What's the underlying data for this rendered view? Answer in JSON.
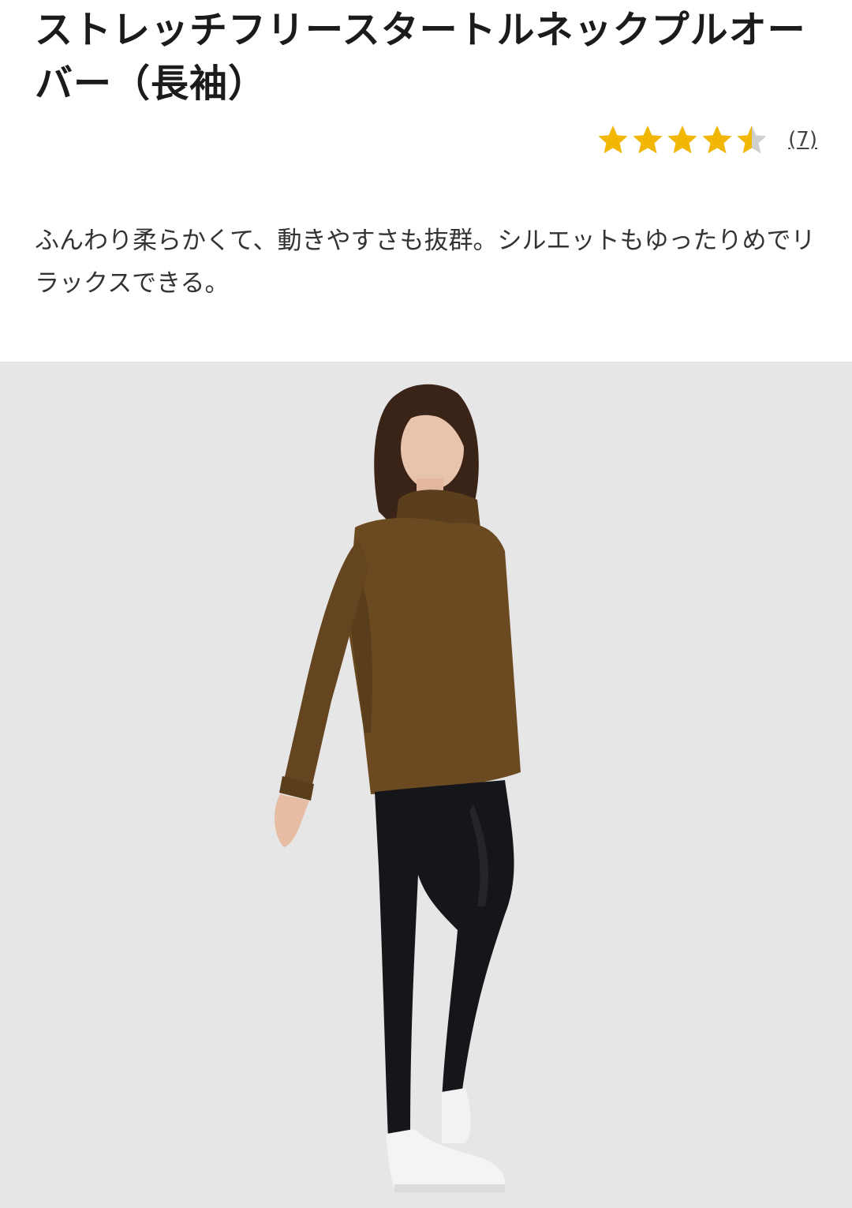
{
  "product": {
    "title": "ストレッチフリースタートルネックプルオーバー（長袖）",
    "description": "ふんわり柔らかくて、動きやすさも抜群。シルエットもゆったりめでリラックスできる。"
  },
  "rating": {
    "value": 4.5,
    "max": 5,
    "review_count": "(7)",
    "star_color": "#f2b705",
    "empty_star_color": "#cfcfcf"
  },
  "image": {
    "background_color": "#e6e6e6",
    "sweater_color": "#6b4a22",
    "pants_color": "#15161a",
    "shoes_color": "#f2f2f2"
  }
}
